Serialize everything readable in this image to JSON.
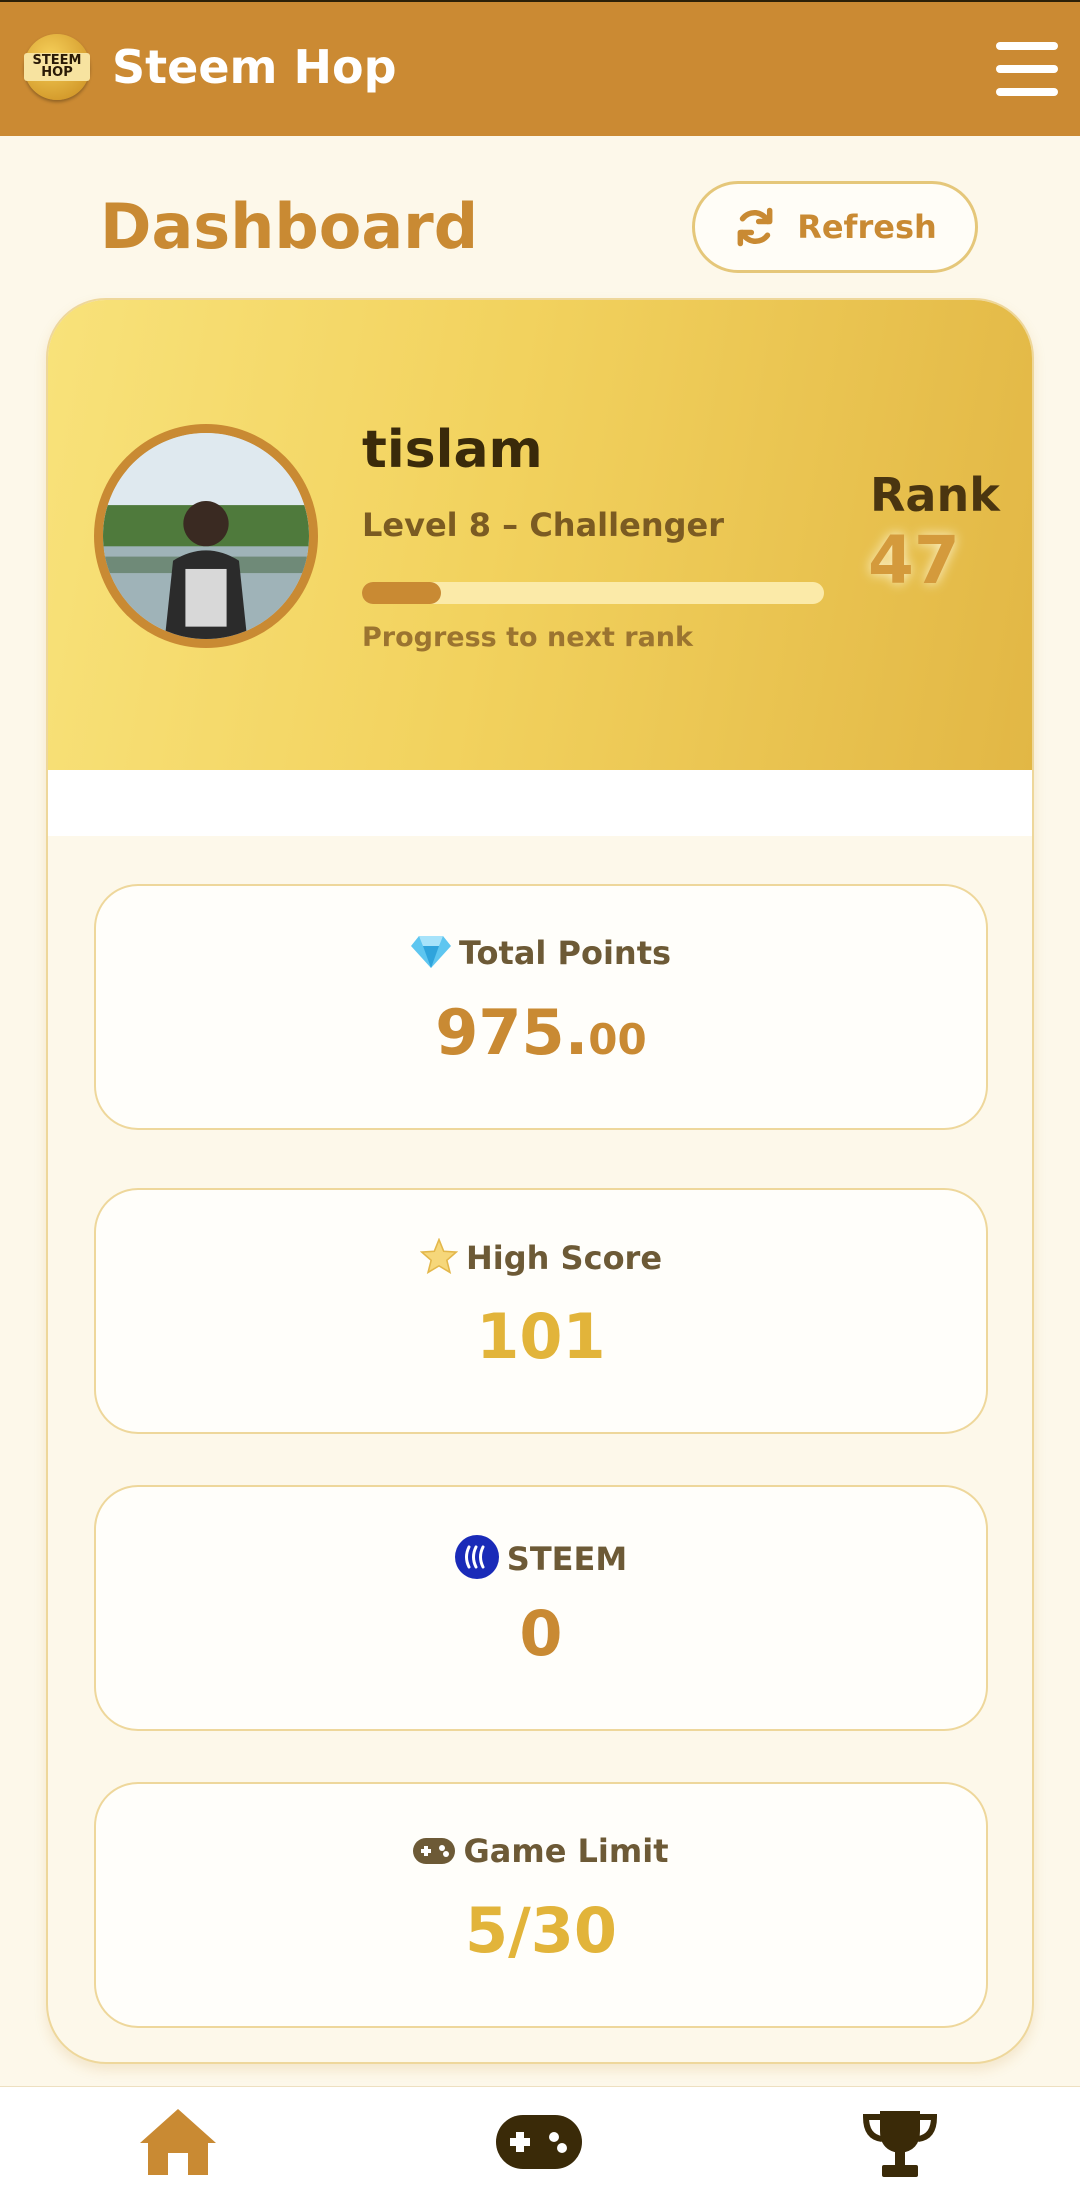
{
  "app": {
    "title": "Steem Hop",
    "logo_text": "STEEM HOP"
  },
  "header": {
    "title": "Dashboard",
    "refresh_label": "Refresh"
  },
  "profile": {
    "username": "tislam",
    "level": "Level 8 – Challenger",
    "progress_label": "Progress to next rank",
    "progress_fraction": 0.17,
    "rank_label": "Rank",
    "rank_value": "47"
  },
  "stats": [
    {
      "label": "Total Points",
      "value_main": "975.",
      "value_dec": "00",
      "icon": "gem-icon",
      "color": "#c98a33"
    },
    {
      "label": "High Score",
      "value": "101",
      "icon": "star-icon",
      "color": "#e2b43a"
    },
    {
      "label": "STEEM",
      "value": "0",
      "icon": "steem-icon",
      "color": "#c98a33"
    },
    {
      "label": "Game Limit",
      "value": "5/30",
      "icon": "gamepad-icon",
      "color": "#e2b43a"
    }
  ],
  "nav": {
    "items": [
      "home-icon",
      "gamepad-icon",
      "trophy-icon"
    ]
  },
  "colors": {
    "topbar": "#cb8a33",
    "accent": "#c98a33",
    "gold": "#e2b43a",
    "background": "#fdf8ea"
  }
}
